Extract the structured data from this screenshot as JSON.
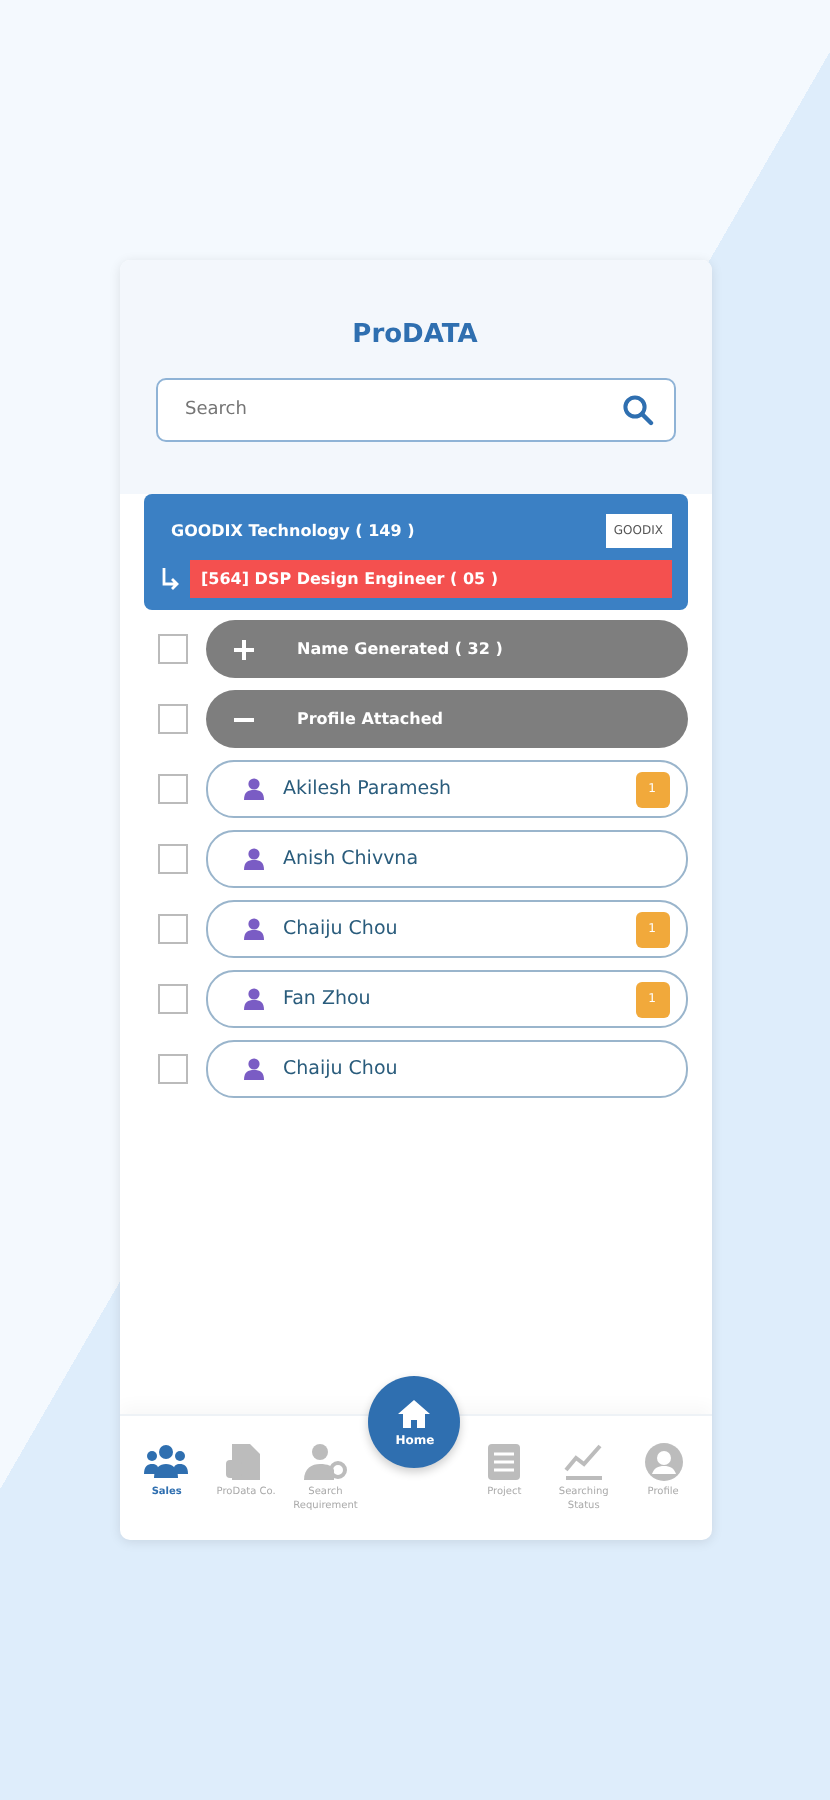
{
  "title": "ProDATA",
  "search": {
    "placeholder": "Search"
  },
  "company": {
    "name": "GOODIX Technology ( 149 )",
    "logo": "GOODIX",
    "position": "[564] DSP Design Engineer ( 05 )"
  },
  "rows": [
    {
      "kind": "group",
      "label": "Name Generated ( 32 )",
      "expanded": false,
      "checked": false
    },
    {
      "kind": "group",
      "label": "Profile Attached",
      "expanded": true,
      "checked": false
    },
    {
      "kind": "person",
      "label": "Akilesh Paramesh",
      "badge": "1",
      "checked": false
    },
    {
      "kind": "person",
      "label": "Anish Chivvna",
      "checked": false
    },
    {
      "kind": "person",
      "label": "Chaiju Chou",
      "badge": "1",
      "checked": false
    },
    {
      "kind": "person",
      "label": "Fan Zhou",
      "badge": "1",
      "checked": false
    },
    {
      "kind": "person",
      "label": "Chaiju Chou",
      "checked": false
    }
  ],
  "nav": [
    {
      "kind": "team",
      "label": "Sales",
      "selected": true
    },
    {
      "kind": "doc",
      "label": "ProData Co.",
      "selected": false
    },
    {
      "kind": "search-user",
      "label": "Search Requirement",
      "selected": false
    },
    {
      "kind": "home",
      "label": "Home",
      "selected": false
    },
    {
      "kind": "list",
      "label": "Project",
      "selected": false
    },
    {
      "kind": "chart",
      "label": "Searching Status",
      "selected": false
    },
    {
      "kind": "profile",
      "label": "Profile",
      "selected": false
    }
  ]
}
